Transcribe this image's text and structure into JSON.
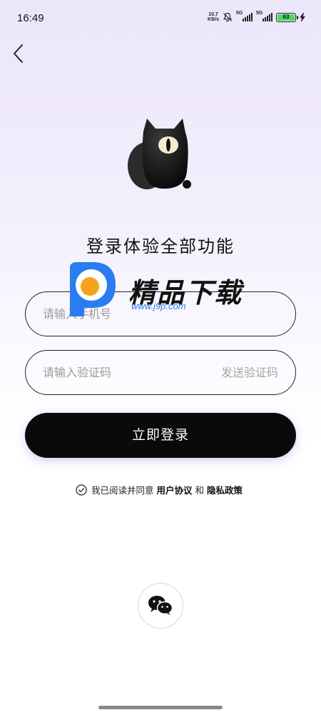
{
  "status_bar": {
    "time": "16:49",
    "net_speed_value": "10.7",
    "net_speed_unit": "KB/s",
    "signal1_label": "5G",
    "signal2_label": "5G",
    "battery": "63"
  },
  "header": {
    "back_icon": "chevron-left-icon"
  },
  "main": {
    "title": "登录体验全部功能",
    "phone_placeholder": "请输入手机号",
    "code_placeholder": "请输入验证码",
    "send_code_label": "发送验证码",
    "login_label": "立即登录"
  },
  "agreement": {
    "prefix": "我已阅读并同意",
    "user_agreement": "用户协议",
    "and": "和",
    "privacy_policy": "隐私政策"
  },
  "social": {
    "wechat_icon": "wechat-icon"
  },
  "watermark": {
    "title": "精品下载",
    "url": "www.j9p.com"
  },
  "colors": {
    "button_bg": "#0a0a0a",
    "accent_orange": "#f4a21c",
    "accent_blue": "#2a7cf0",
    "battery_green": "#4cd964"
  }
}
